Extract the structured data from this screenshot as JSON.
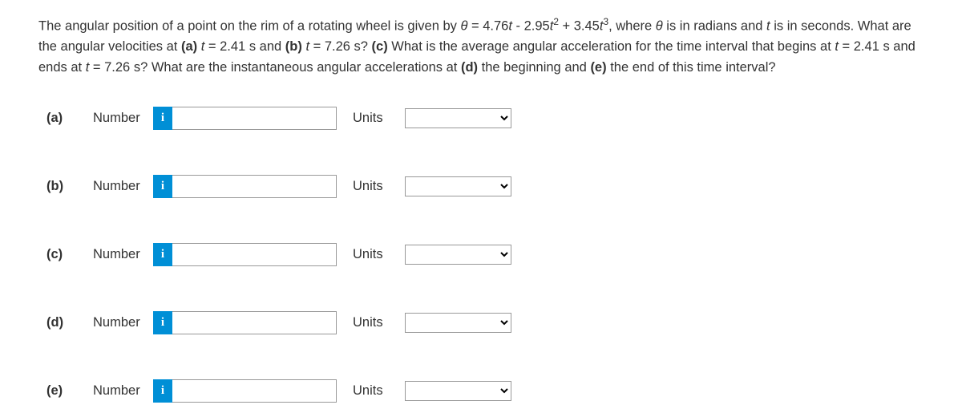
{
  "problem": {
    "text_html": "The angular position of a point on the rim of a rotating wheel is given by <span class=\"var\">θ</span> = 4.76<span class=\"var\">t</span> - 2.95<span class=\"var\">t</span><sup>2</sup> + 3.45<span class=\"var\">t</span><sup>3</sup>, where <span class=\"var\">θ</span> is in radians and <span class=\"var\">t</span> is in seconds. What are the angular velocities at <span class=\"bold\">(a)</span> <span class=\"var\">t</span> = 2.41 s and <span class=\"bold\">(b)</span> <span class=\"var\">t</span> = 7.26 s? <span class=\"bold\">(c)</span> What is the average angular acceleration for the time interval that begins at <span class=\"var\">t</span> = 2.41 s and ends at <span class=\"var\">t</span> = 7.26 s? What are the instantaneous angular accelerations at <span class=\"bold\">(d)</span> the beginning and <span class=\"bold\">(e)</span> the end of this time interval?"
  },
  "labels": {
    "number": "Number",
    "units": "Units",
    "info": "i"
  },
  "parts": [
    {
      "id": "a",
      "label": "(a)"
    },
    {
      "id": "b",
      "label": "(b)"
    },
    {
      "id": "c",
      "label": "(c)"
    },
    {
      "id": "d",
      "label": "(d)"
    },
    {
      "id": "e",
      "label": "(e)"
    }
  ]
}
